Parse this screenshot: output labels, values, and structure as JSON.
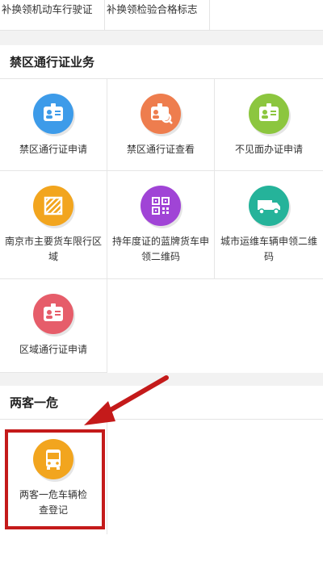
{
  "top_row": {
    "items": [
      "补换领机动车行驶证",
      "补换领检验合格标志"
    ]
  },
  "section_restricted": {
    "title": "禁区通行证业务",
    "items": [
      {
        "label": "禁区通行证申请",
        "icon": "id-card-icon",
        "color": "#3d9be9"
      },
      {
        "label": "禁区通行证查看",
        "icon": "id-card-search-icon",
        "color": "#ee7d4e"
      },
      {
        "label": "不见面办证申请",
        "icon": "id-card-icon",
        "color": "#8cc63f"
      },
      {
        "label": "南京市主要货车限行区域",
        "icon": "restricted-area-icon",
        "color": "#f2a51e"
      },
      {
        "label": "持年度证的蓝牌货车申领二维码",
        "icon": "qr-code-icon",
        "color": "#a044d6"
      },
      {
        "label": "城市运维车辆申领二维码",
        "icon": "truck-icon",
        "color": "#25b39a"
      },
      {
        "label": "区域通行证申请",
        "icon": "id-card-icon",
        "color": "#e65d6a"
      }
    ]
  },
  "section_hazard": {
    "title": "两客一危",
    "items": [
      {
        "label": "两客一危车辆检查登记",
        "icon": "bus-icon",
        "color": "#f2a51e"
      }
    ]
  },
  "colors": {
    "highlight": "#c41a1a",
    "arrow": "#c41a1a"
  }
}
